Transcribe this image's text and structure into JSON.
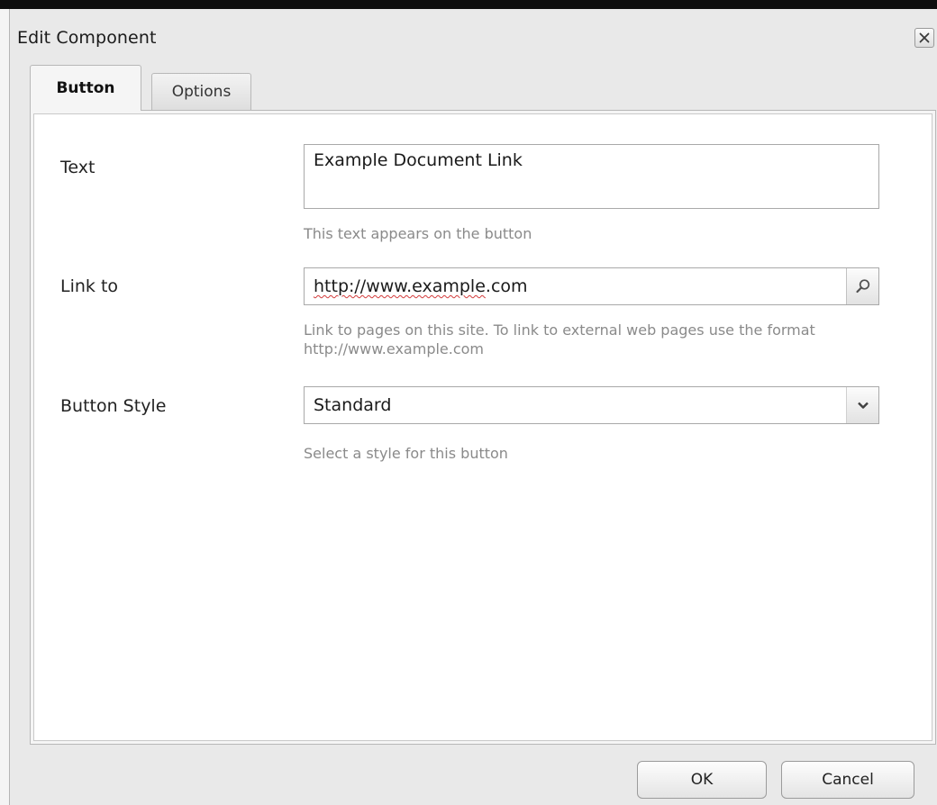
{
  "dialog": {
    "title": "Edit Component",
    "close_icon": "close-icon"
  },
  "tabs": [
    {
      "label": "Button",
      "active": true
    },
    {
      "label": "Options",
      "active": false
    }
  ],
  "form": {
    "text": {
      "label": "Text",
      "value": "Example Document Link",
      "hint": "This text appears on the button"
    },
    "link": {
      "label": "Link to",
      "value_part1": "http://www.example",
      "value_part2": ".com",
      "hint": "Link to pages on this site. To link to external web pages use the format http://www.example.com",
      "icon": "search-icon"
    },
    "style": {
      "label": "Button Style",
      "value": "Standard",
      "hint": "Select a style for this button",
      "icon": "chevron-down-icon"
    }
  },
  "footer": {
    "ok_label": "OK",
    "cancel_label": "Cancel"
  }
}
